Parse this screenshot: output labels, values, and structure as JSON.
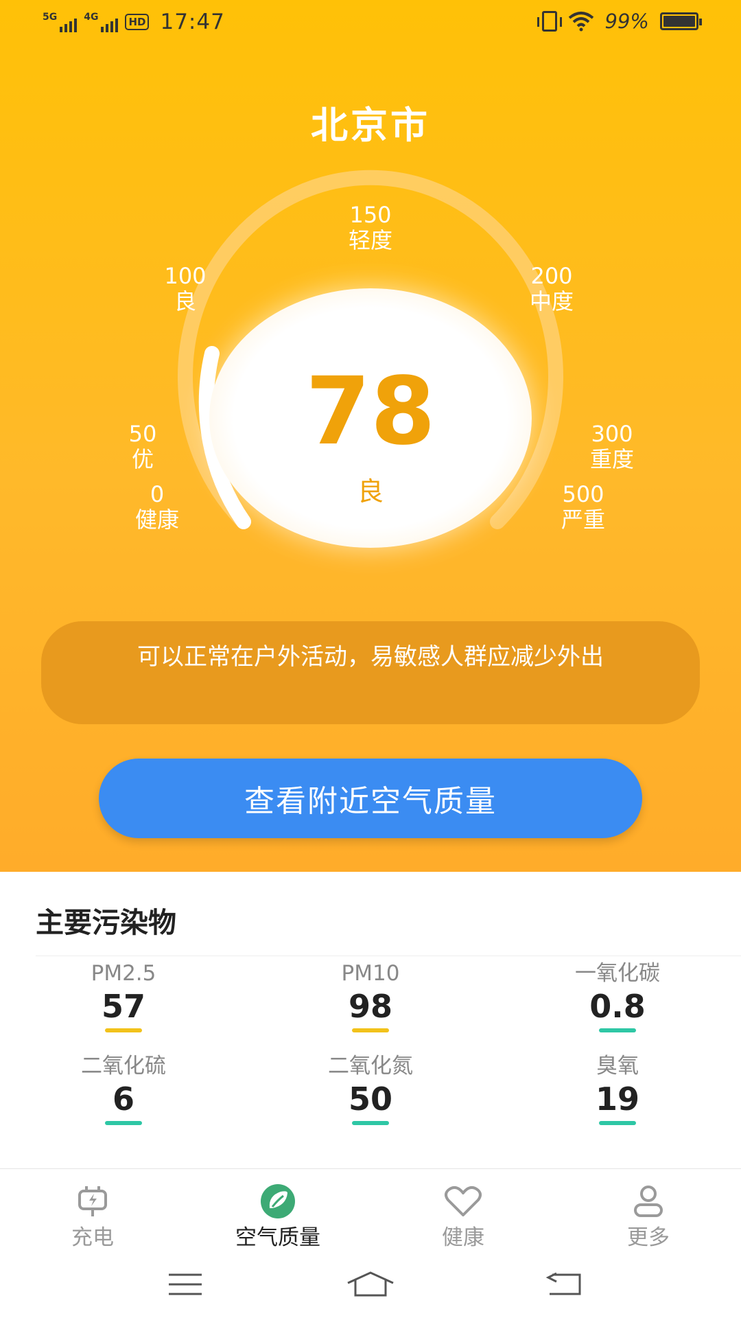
{
  "status_bar": {
    "sim1": "5G",
    "sim2": "4G",
    "hd": "HD",
    "time": "17:47",
    "battery_pct": "99%",
    "battery_level": 0.99
  },
  "city": "北京市",
  "gauge": {
    "labels": [
      {
        "value": "0",
        "text": "健康"
      },
      {
        "value": "50",
        "text": "优"
      },
      {
        "value": "100",
        "text": "良"
      },
      {
        "value": "150",
        "text": "轻度"
      },
      {
        "value": "200",
        "text": "中度"
      },
      {
        "value": "300",
        "text": "重度"
      },
      {
        "value": "500",
        "text": "严重"
      }
    ],
    "aqi": "78",
    "level": "良",
    "progress_value": 78,
    "colors": {
      "track": "#ffd27a",
      "fill": "#ffffff",
      "value_text": "#f0a20a"
    }
  },
  "advice": "可以正常在户外活动，易敏感人群应减少外出",
  "nearby_button": "查看附近空气质量",
  "pollutants": {
    "title": "主要污染物",
    "items": [
      {
        "name": "PM2.5",
        "value": "57",
        "bar_color": "#f2c21b"
      },
      {
        "name": "PM10",
        "value": "98",
        "bar_color": "#f2c21b"
      },
      {
        "name": "一氧化碳",
        "value": "0.8",
        "bar_color": "#2ec7a5"
      },
      {
        "name": "二氧化硫",
        "value": "6",
        "bar_color": "#2ec7a5"
      },
      {
        "name": "二氧化氮",
        "value": "50",
        "bar_color": "#2ec7a5"
      },
      {
        "name": "臭氧",
        "value": "19",
        "bar_color": "#2ec7a5"
      }
    ]
  },
  "tabs": [
    {
      "label": "充电",
      "icon": "charging-plug-icon",
      "active": false
    },
    {
      "label": "空气质量",
      "icon": "leaf-icon",
      "active": true
    },
    {
      "label": "健康",
      "icon": "heart-icon",
      "active": false
    },
    {
      "label": "更多",
      "icon": "user-icon",
      "active": false
    }
  ],
  "nav": [
    "menu-icon",
    "home-icon",
    "back-icon"
  ]
}
